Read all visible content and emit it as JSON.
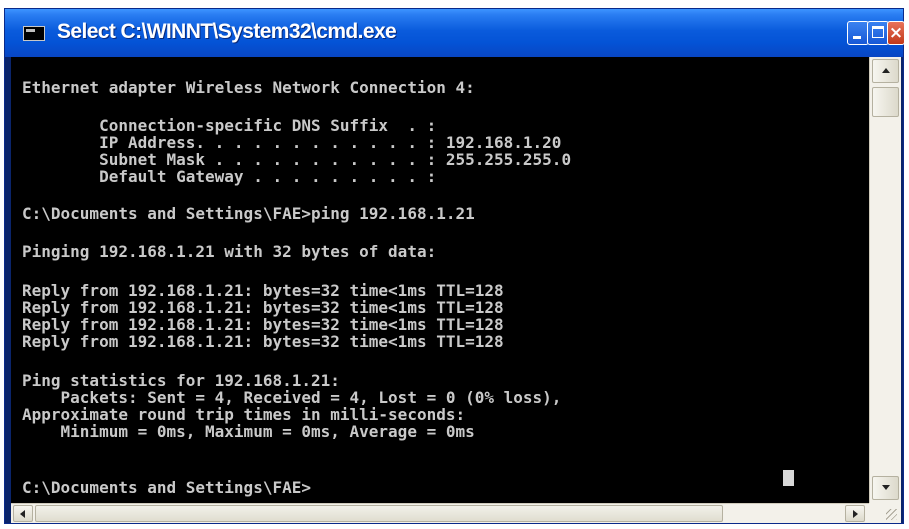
{
  "window": {
    "title": "Select C:\\WINNT\\System32\\cmd.exe",
    "title_bar_color": "#0a5bdc",
    "icon": "console-icon",
    "controls": {
      "minimize_icon": "minimize-icon",
      "maximize_icon": "maximize-icon",
      "close_label": "×"
    }
  },
  "console": {
    "background": "#000000",
    "foreground": "#c0c0c0",
    "lines": [
      "Ethernet adapter Wireless Network Connection 4:",
      "        Connection-specific DNS Suffix  . :",
      "        IP Address. . . . . . . . . . . . : 192.168.1.20",
      "        Subnet Mask . . . . . . . . . . . : 255.255.255.0",
      "        Default Gateway . . . . . . . . . :",
      "C:\\Documents and Settings\\FAE>ping 192.168.1.21",
      "Pinging 192.168.1.21 with 32 bytes of data:",
      "Reply from 192.168.1.21: bytes=32 time<1ms TTL=128",
      "Reply from 192.168.1.21: bytes=32 time<1ms TTL=128",
      "Reply from 192.168.1.21: bytes=32 time<1ms TTL=128",
      "Reply from 192.168.1.21: bytes=32 time<1ms TTL=128",
      "Ping statistics for 192.168.1.21:",
      "    Packets: Sent = 4, Received = 4, Lost = 0 (0% loss),",
      "Approximate round trip times in milli-seconds:",
      "    Minimum = 0ms, Maximum = 0ms, Average = 0ms",
      "C:\\Documents and Settings\\FAE>"
    ]
  },
  "scrollbars": {
    "vertical": {
      "up_icon": "scroll-up-arrow-icon",
      "down_icon": "scroll-down-arrow-icon"
    },
    "horizontal": {
      "left_icon": "scroll-left-arrow-icon",
      "right_icon": "scroll-right-arrow-icon"
    }
  }
}
